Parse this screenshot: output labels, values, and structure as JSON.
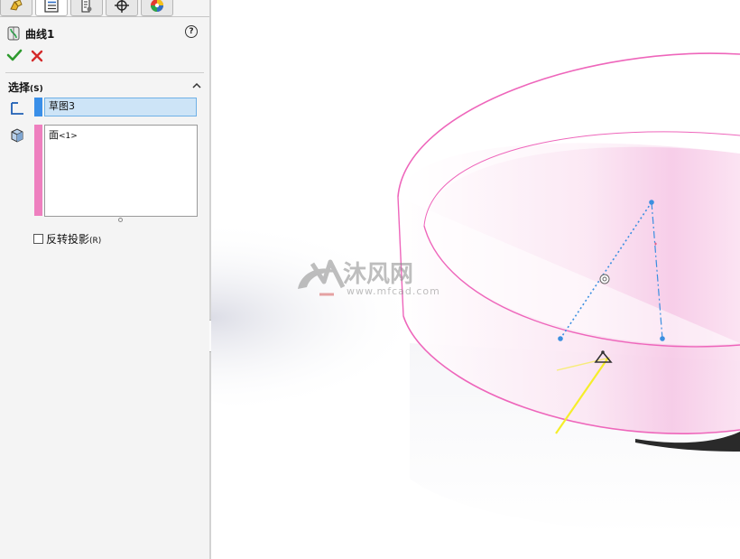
{
  "panel": {
    "tabs": [
      {
        "icon": "feature-manager-icon",
        "active": false
      },
      {
        "icon": "property-manager-icon",
        "active": true
      },
      {
        "icon": "configuration-manager-icon",
        "active": false
      },
      {
        "icon": "dimxpert-icon",
        "active": false
      },
      {
        "icon": "display-manager-icon",
        "active": false
      }
    ],
    "title": "曲线1",
    "help": "?",
    "section": {
      "title": "选择",
      "accelerator": "(S)"
    },
    "sketch_field_value": "草图3",
    "face_field": {
      "label": "面",
      "suffix": "<1>"
    },
    "reverse_projection": {
      "label": "反转投影",
      "accelerator": "(R)",
      "checked": false
    }
  },
  "colors": {
    "sketch_selection": "#3a8fe8",
    "face_selection": "#ee7fbf",
    "ok": "#2e9a2e",
    "cancel": "#d42a2a",
    "edge_highlight": "#ee66bb",
    "sketch_line": "#3b8fe0",
    "projected_curve": "#f5ee2a"
  },
  "watermark": {
    "title": "沐风网",
    "url": "www.mfcad.com"
  }
}
